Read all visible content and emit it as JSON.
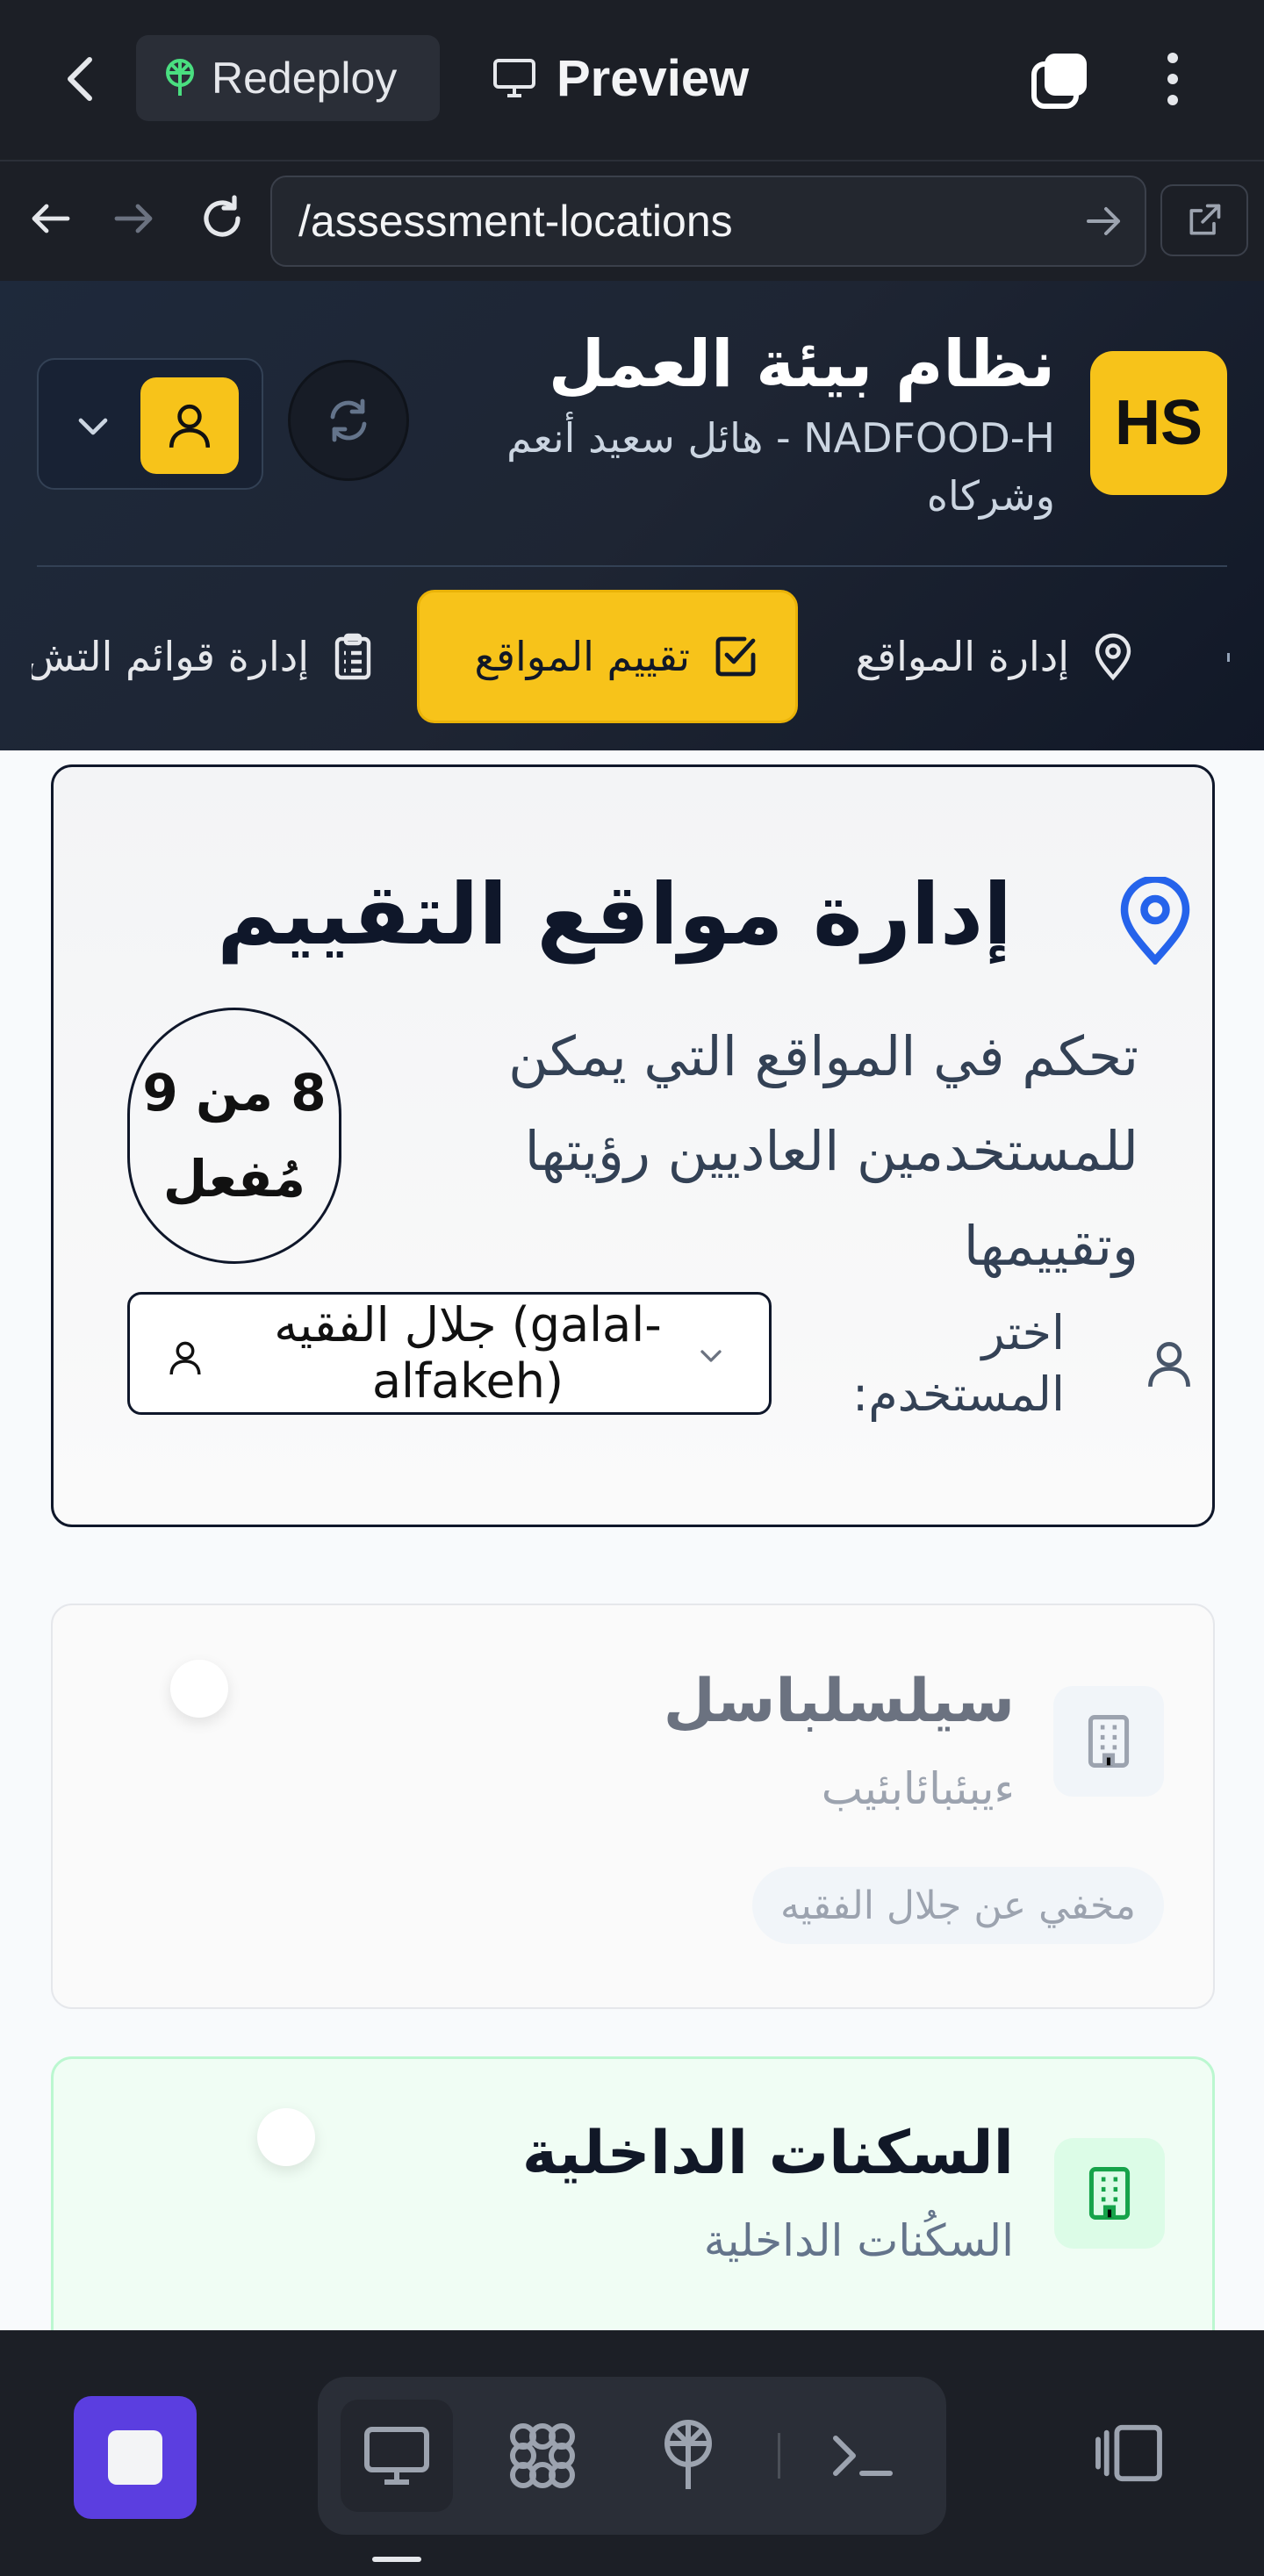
{
  "browser": {
    "back_label": "‹",
    "redeploy_label": "Redeploy",
    "preview_label": "Preview",
    "url": "/assessment-locations"
  },
  "app": {
    "logo_text": "HS",
    "title": "نظام بيئة العمل",
    "subtitle": "NADFOOD-H - هائل سعيد أنعم وشركاه"
  },
  "nav": {
    "tabs": [
      {
        "label": "إدارة المواقع",
        "icon": "map-pin-icon",
        "active": false
      },
      {
        "label": "تقييم المواقع",
        "icon": "check-square-icon",
        "active": true
      },
      {
        "label": "إدارة قوائم التش",
        "icon": "clipboard-list-icon",
        "active": false
      }
    ]
  },
  "panel": {
    "title": "إدارة مواقع التقييم",
    "description": "تحكم في المواقع التي يمكن للمستخدمين العاديين رؤيتها وتقييمها",
    "count_text": "8 من 9 مُفعل",
    "user_label": "اختر المستخدم:",
    "selected_user": "جلال الفقيه (galal-alfakeh)"
  },
  "locations": [
    {
      "name": "سيلسلباسل",
      "description": "ءيبئبائابئيب",
      "badge": "مخفي عن جلال الفقيه",
      "visible": false,
      "accent": "#9ca3af"
    },
    {
      "name": "السكنات الداخلية",
      "description": "السكُنات الداخلية",
      "badge": "",
      "visible": true,
      "accent": "#16a34a"
    }
  ],
  "colors": {
    "brand_yellow": "#f7c31a",
    "header_bg": "#1e293b",
    "pin_blue": "#2563eb",
    "stop_purple": "#5b3ee0"
  }
}
